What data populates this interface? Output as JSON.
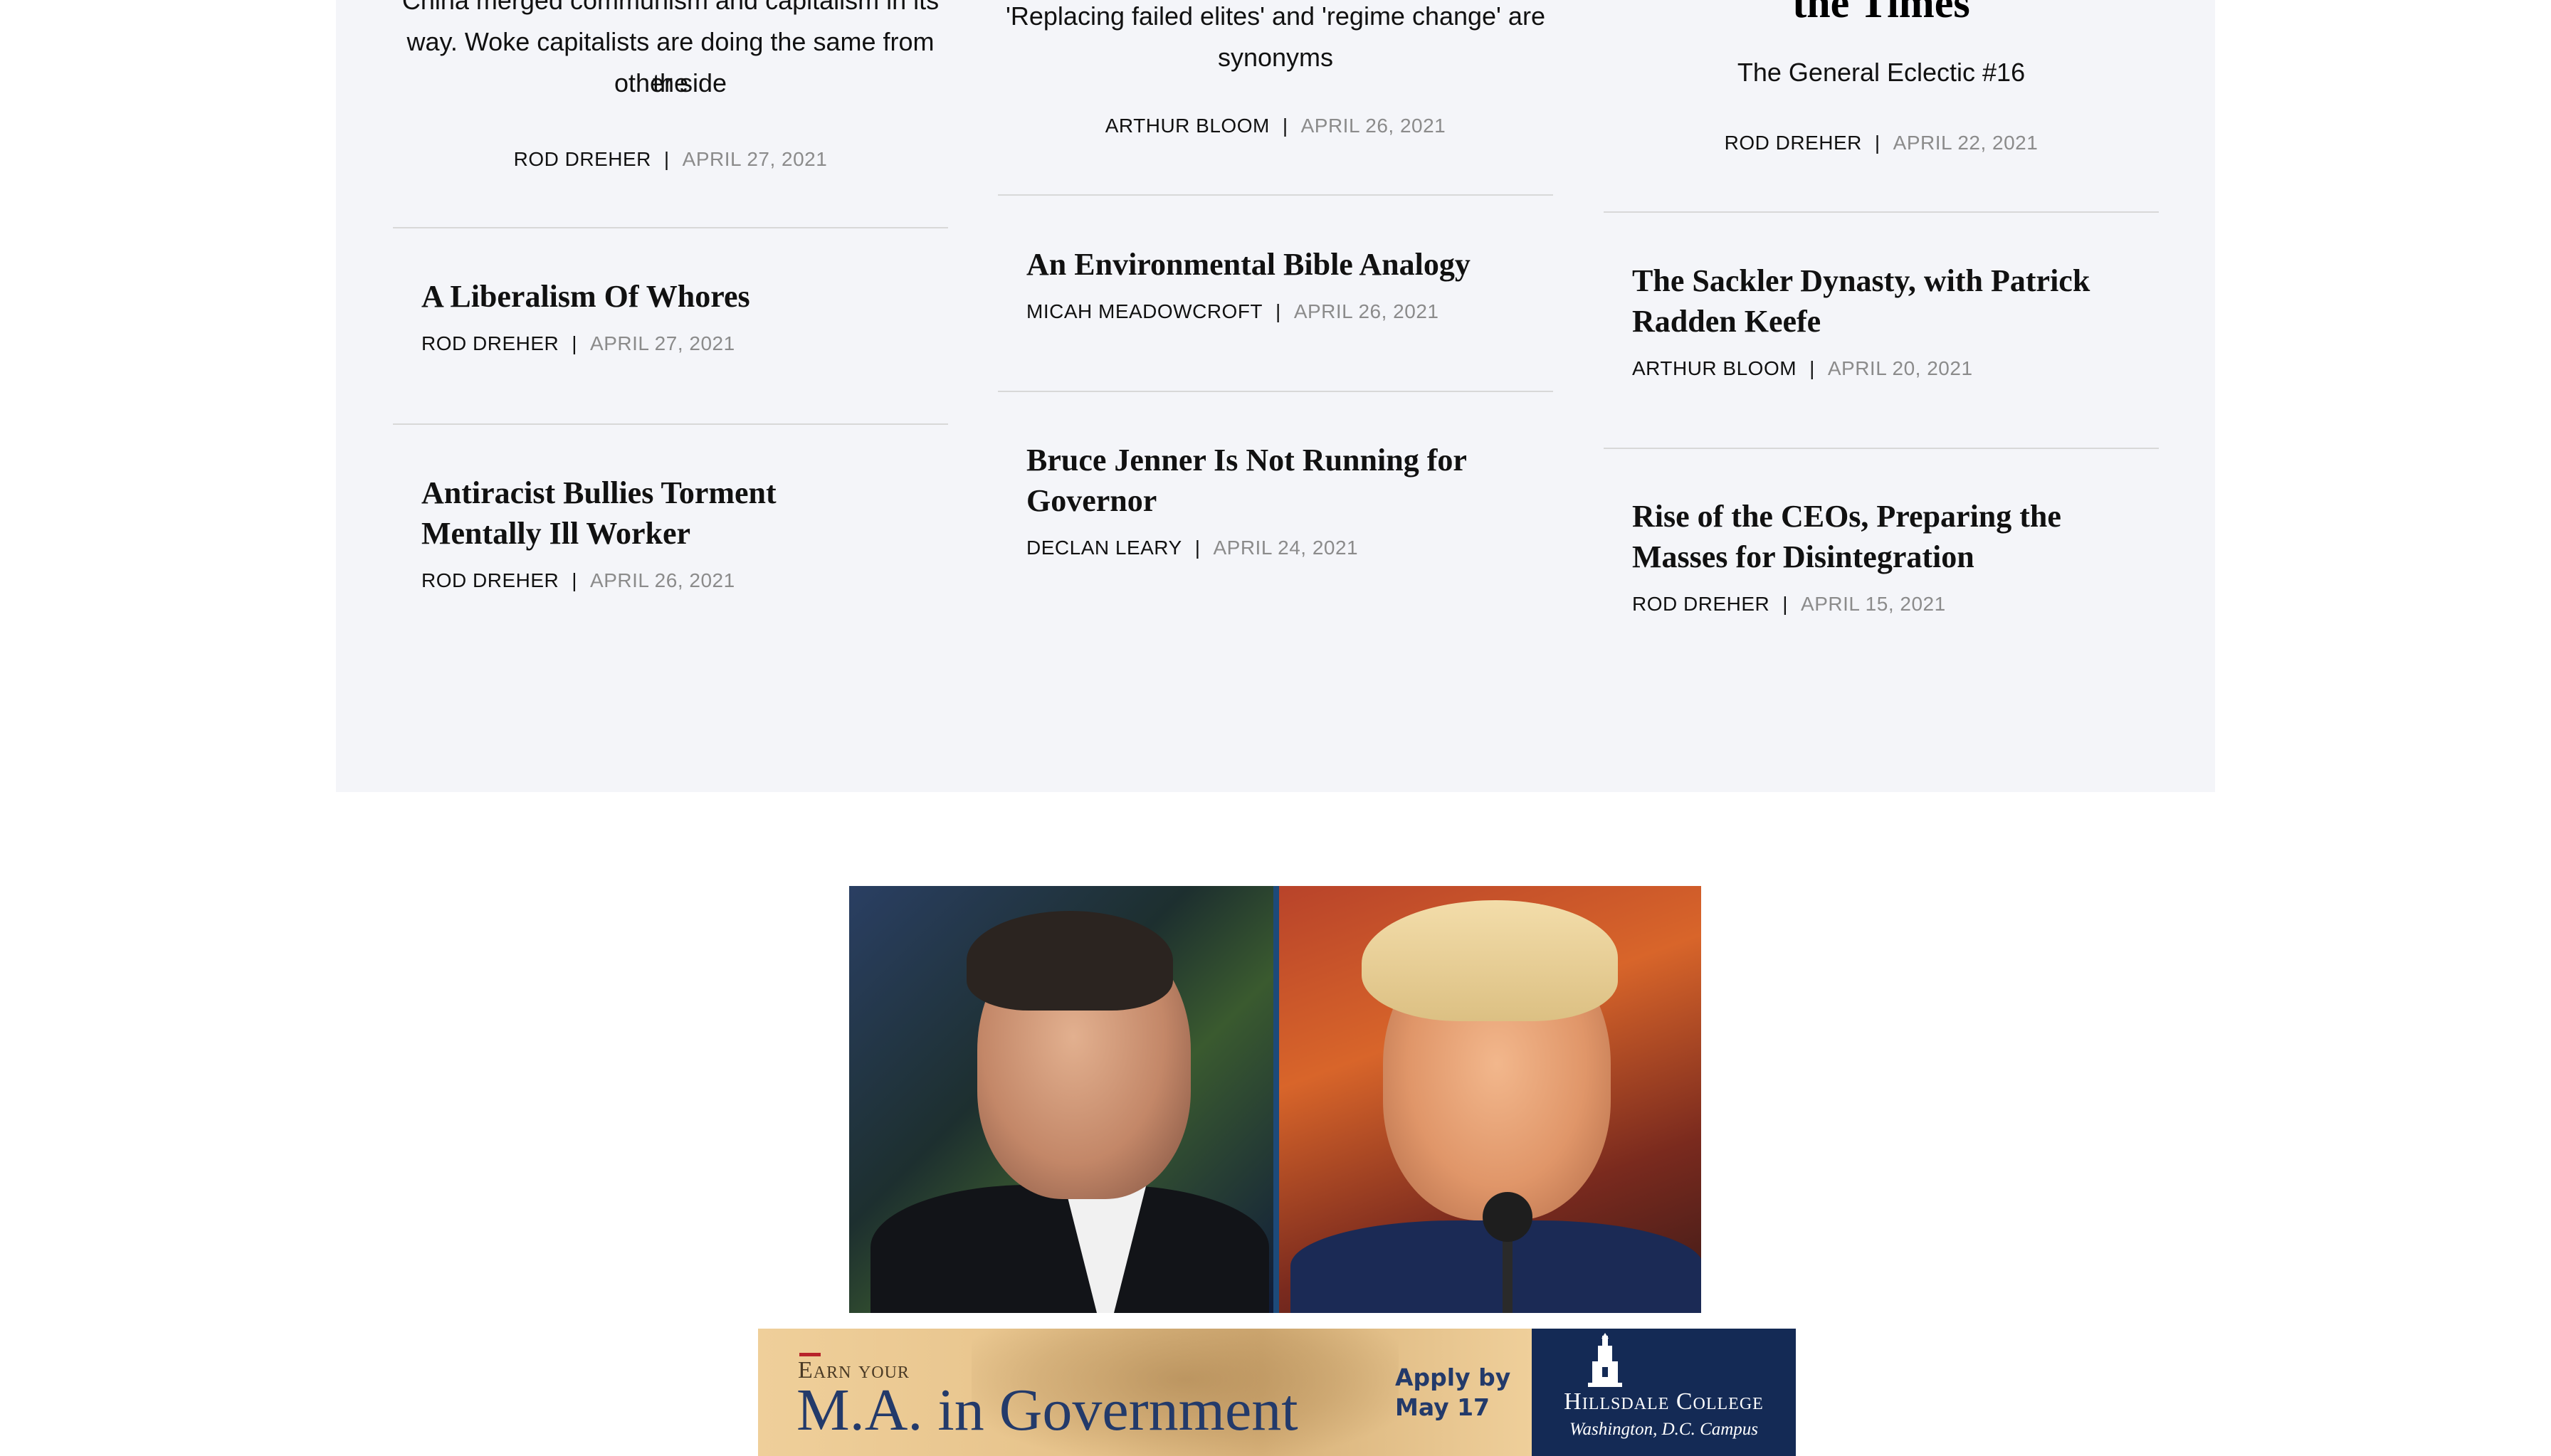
{
  "columns": [
    {
      "lead": {
        "title": "",
        "subtitle_lines": [
          "China merged communism and capitalism in its",
          "way. Woke capitalists are doing the same from the",
          "other side"
        ],
        "author": "ROD DREHER",
        "date": "APRIL 27, 2021"
      },
      "items": [
        {
          "title_lines": [
            "A Liberalism Of Whores"
          ],
          "author": "ROD DREHER",
          "date": "APRIL 27, 2021"
        },
        {
          "title_lines": [
            "Antiracist Bullies Torment",
            "Mentally Ill Worker"
          ],
          "author": "ROD DREHER",
          "date": "APRIL 26, 2021"
        }
      ]
    },
    {
      "lead": {
        "title": "",
        "subtitle_lines": [
          "'Replacing failed elites' and 'regime change' are",
          "synonyms"
        ],
        "author": "ARTHUR BLOOM",
        "date": "APRIL 26, 2021"
      },
      "items": [
        {
          "title_lines": [
            "An Environmental Bible Analogy"
          ],
          "author": "MICAH MEADOWCROFT",
          "date": "APRIL 26, 2021"
        },
        {
          "title_lines": [
            "Bruce Jenner Is Not Running for",
            "Governor"
          ],
          "author": "DECLAN LEARY",
          "date": "APRIL 24, 2021"
        }
      ]
    },
    {
      "lead": {
        "title": "the Times",
        "subtitle_lines": [
          "The General Eclectic #16"
        ],
        "author": "ROD DREHER",
        "date": "APRIL 22, 2021"
      },
      "items": [
        {
          "title_lines": [
            "The Sackler Dynasty, with Patrick",
            "Radden Keefe"
          ],
          "author": "ARTHUR BLOOM",
          "date": "APRIL 20, 2021"
        },
        {
          "title_lines": [
            "Rise of the CEOs, Preparing the",
            "Masses for Disintegration"
          ],
          "author": "ROD DREHER",
          "date": "APRIL 15, 2021"
        }
      ]
    }
  ],
  "meta_separator": "|",
  "ad": {
    "eyebrow": "Earn your",
    "headline": "M.A. in Government",
    "cta_lines": [
      "Apply by",
      "May 17"
    ],
    "college": "Hillsdale College",
    "campus": "Washington, D.C. Campus"
  },
  "colors": {
    "section_bg": "#f4f5f9",
    "divider": "#d8d8d8",
    "date_gray": "#8b8b8b",
    "ad_navy": "#142a55",
    "ad_text_blue": "#233a6a",
    "ad_red": "#b8232a"
  }
}
